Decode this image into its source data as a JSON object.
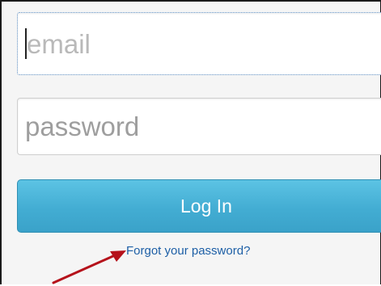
{
  "login_form": {
    "email_placeholder": "email",
    "password_placeholder": "password",
    "login_button_label": "Log In",
    "forgot_password_link": "Forgot your password?"
  },
  "colors": {
    "button_top": "#5cc3e4",
    "button_bottom": "#3aa2c9",
    "link": "#1d5fa6",
    "annotation_arrow": "#b5121b"
  },
  "annotation": {
    "icon": "red-arrow-icon"
  }
}
